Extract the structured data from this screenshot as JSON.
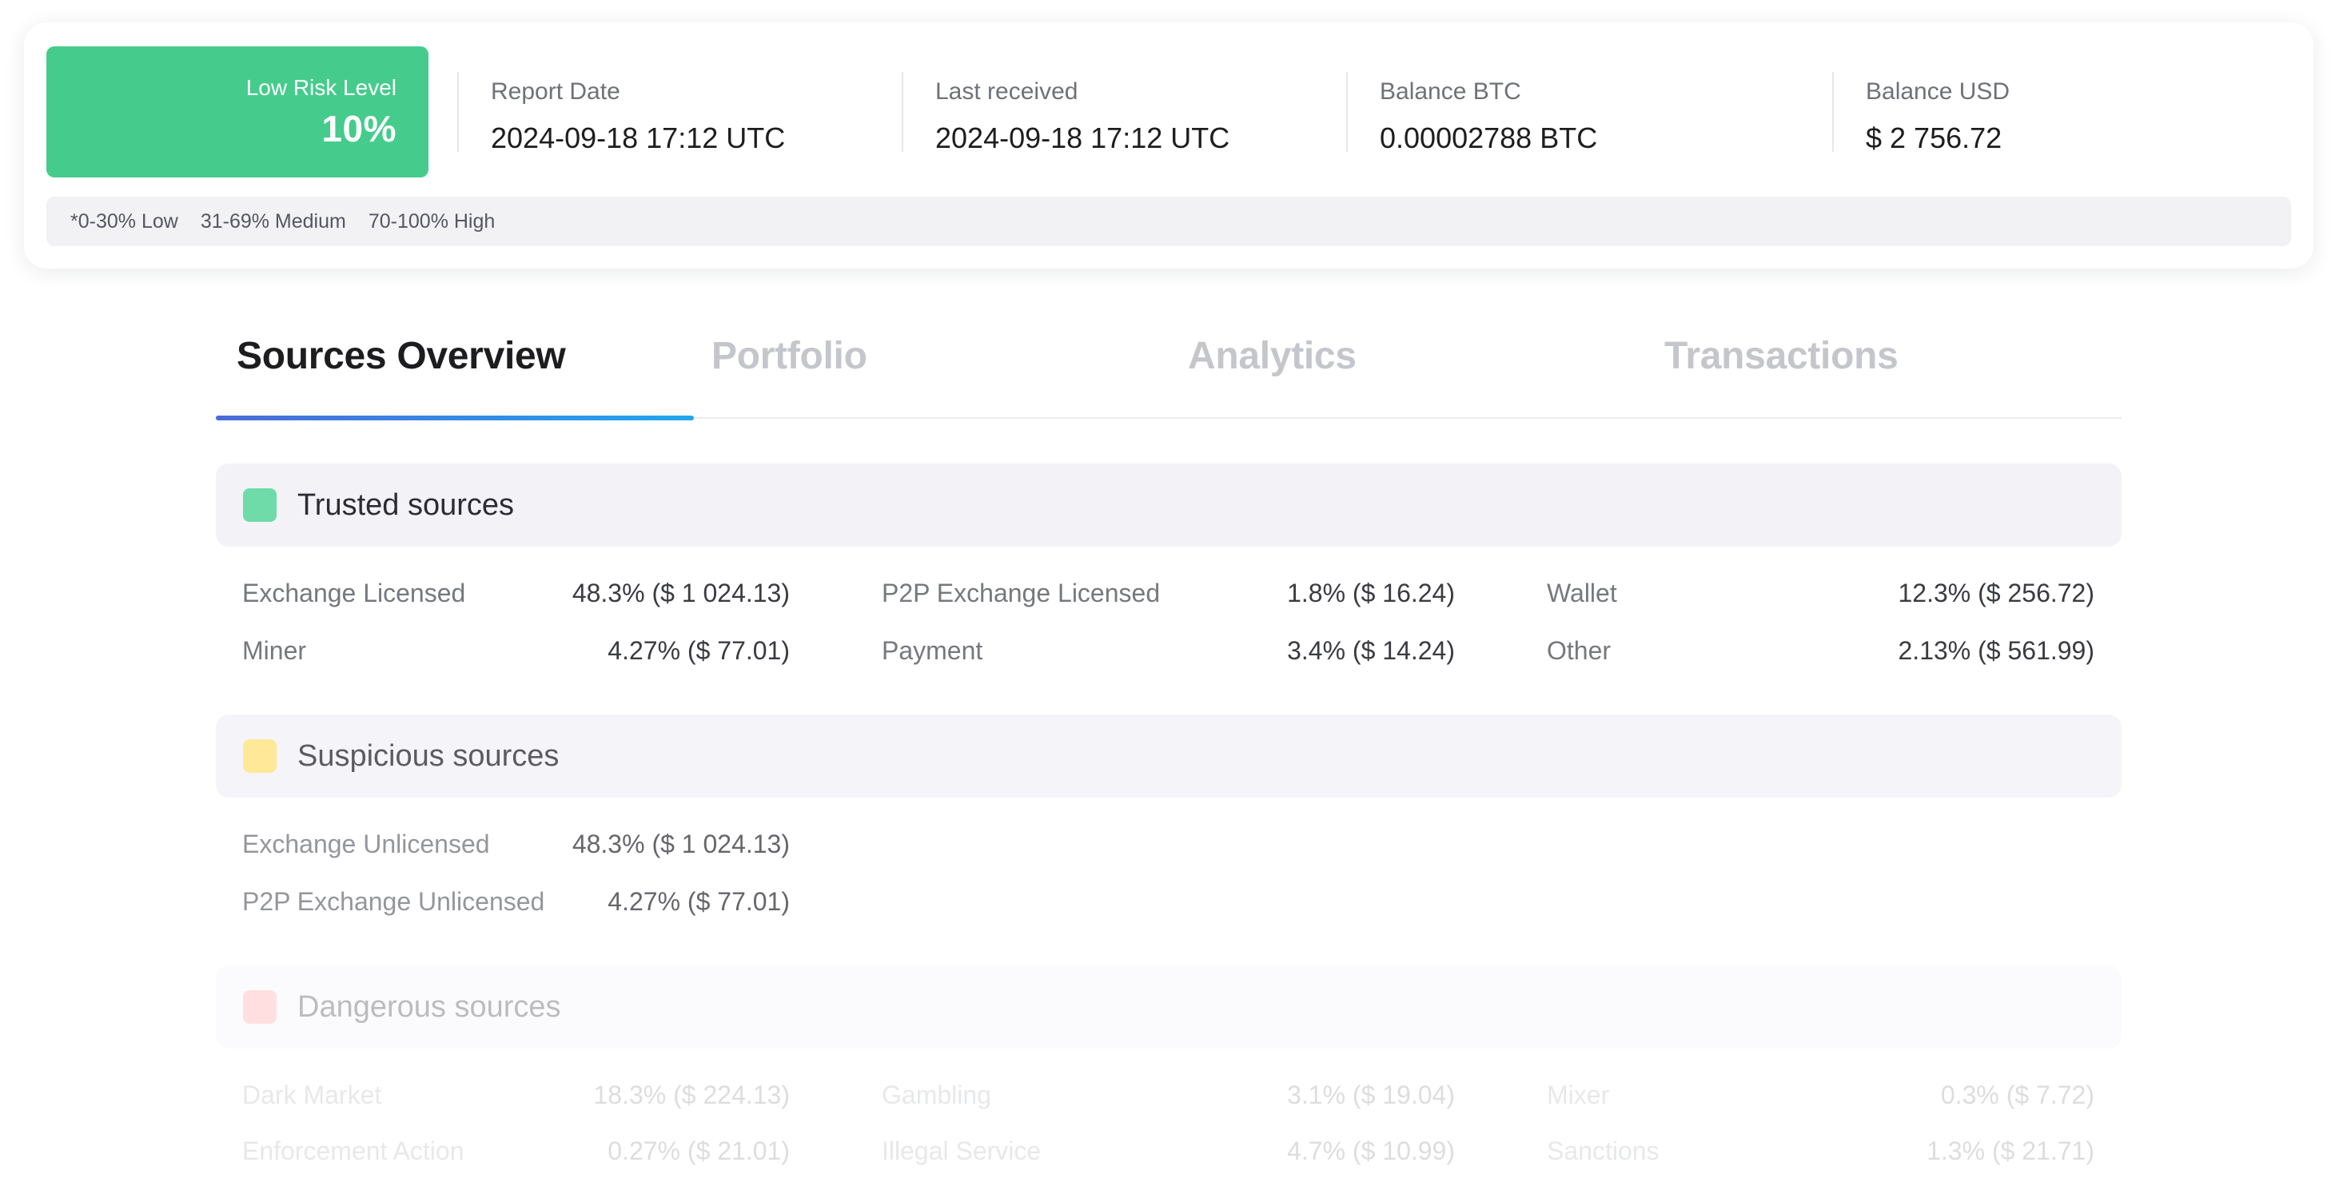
{
  "risk": {
    "label": "Low Risk Level",
    "value": "10%",
    "color": "#45cc8c"
  },
  "stats": [
    {
      "label": "Report Date",
      "value": "2024-09-18 17:12 UTC"
    },
    {
      "label": "Last received",
      "value": "2024-09-18 17:12 UTC"
    },
    {
      "label": "Balance BTC",
      "value": "0.00002788 BTC"
    },
    {
      "label": "Balance USD",
      "value": "$ 2 756.72"
    }
  ],
  "legend": [
    "*0-30% Low",
    "31-69% Medium",
    "70-100% High"
  ],
  "tabs": [
    {
      "label": "Sources Overview",
      "active": true
    },
    {
      "label": "Portfolio",
      "active": false
    },
    {
      "label": "Analytics",
      "active": false
    },
    {
      "label": "Transactions",
      "active": false
    }
  ],
  "sections": {
    "trusted": {
      "title": "Trusted sources",
      "color": "#6fdba8",
      "rows": [
        [
          {
            "label": "Exchange Licensed",
            "value": "48.3% ($ 1 024.13)"
          },
          {
            "label": "P2P Exchange Licensed",
            "value": "1.8% ($ 16.24)"
          },
          {
            "label": "Wallet",
            "value": "12.3% ($ 256.72)"
          }
        ],
        [
          {
            "label": "Miner",
            "value": "4.27% ($ 77.01)"
          },
          {
            "label": "Payment",
            "value": "3.4% ($ 14.24)"
          },
          {
            "label": "Other",
            "value": "2.13% ($ 561.99)"
          }
        ]
      ]
    },
    "suspicious": {
      "title": "Suspicious sources",
      "color": "#ffe27a",
      "rows": [
        [
          {
            "label": "Exchange Unlicensed",
            "value": "48.3% ($ 1 024.13)"
          }
        ],
        [
          {
            "label": "P2P Exchange Unlicensed",
            "value": "4.27% ($ 77.01)"
          }
        ]
      ]
    },
    "dangerous": {
      "title": "Dangerous sources",
      "color": "#ff9c9c",
      "rows": [
        [
          {
            "label": "Dark Market",
            "value": "18.3% ($ 224.13)"
          },
          {
            "label": "Gambling",
            "value": "3.1% ($ 19.04)"
          },
          {
            "label": "Mixer",
            "value": "0.3% ($ 7.72)"
          }
        ],
        [
          {
            "label": "Enforcement Action",
            "value": "0.27% ($ 21.01)"
          },
          {
            "label": "Illegal Service",
            "value": "4.7% ($ 10.99)"
          },
          {
            "label": "Sanctions",
            "value": "1.3% ($ 21.71)"
          }
        ]
      ]
    }
  }
}
